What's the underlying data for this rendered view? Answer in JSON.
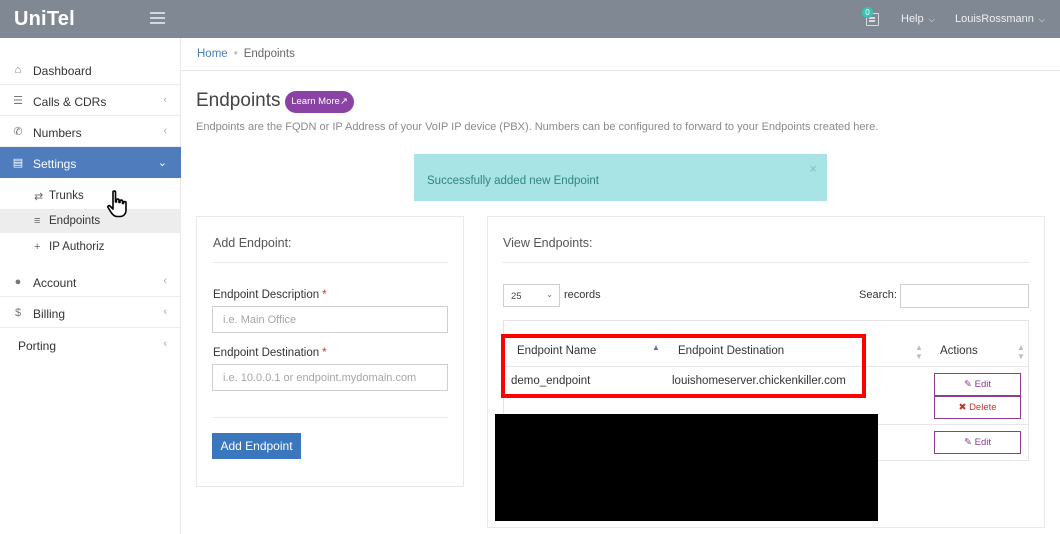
{
  "app": {
    "brand": "UniTel"
  },
  "topbar": {
    "notification_count": "0",
    "help_label": "Help",
    "user_label": "LouisRossmann"
  },
  "sidebar": {
    "items": [
      {
        "label": "Dashboard",
        "icon": "home-icon"
      },
      {
        "label": "Calls & CDRs",
        "icon": "list-icon"
      },
      {
        "label": "Numbers",
        "icon": "phone-icon"
      },
      {
        "label": "Settings",
        "icon": "server-icon",
        "active": true
      },
      {
        "label": "Account",
        "icon": "user-icon"
      },
      {
        "label": "Billing",
        "icon": "dollar-icon"
      },
      {
        "label": "Porting"
      }
    ],
    "settings_sub": [
      {
        "label": "Trunks",
        "icon": "exchange-icon"
      },
      {
        "label": "Endpoints",
        "icon": "stack-icon"
      },
      {
        "label": "IP Authoriz",
        "icon": "plus-icon"
      }
    ]
  },
  "breadcrumb": {
    "home": "Home",
    "current": "Endpoints"
  },
  "page": {
    "title": "Endpoints",
    "learn_more": "Learn More",
    "subtitle": "Endpoints are the FQDN or IP Address of your VoIP IP device (PBX). Numbers can be configured to forward to your Endpoints created here."
  },
  "alert": {
    "message": "Successfully added new Endpoint",
    "close": "×"
  },
  "add_form": {
    "title": "Add Endpoint:",
    "description_label": "Endpoint Description",
    "description_placeholder": "i.e. Main Office",
    "destination_label": "Endpoint Destination",
    "destination_placeholder": "i.e. 10.0.0.1 or endpoint.mydomain.com",
    "required_mark": "*",
    "submit_label": "Add Endpoint"
  },
  "view_panel": {
    "title": "View Endpoints:",
    "records_value": "25",
    "records_label": "records",
    "search_label": "Search:",
    "columns": [
      "Endpoint Name",
      "Endpoint Destination",
      "Actions"
    ],
    "rows": [
      {
        "name": "demo_endpoint",
        "destination": "louishomeserver.chickenkiller.com"
      }
    ],
    "edit_label": "Edit",
    "delete_label": "Delete"
  },
  "colors": {
    "topbar": "#808894",
    "sidebar_active": "#4f7cbd",
    "alert_bg": "#a8e3e6",
    "primary": "#3a77be",
    "learn_more": "#8a43a5",
    "highlight": "#ff0000"
  }
}
